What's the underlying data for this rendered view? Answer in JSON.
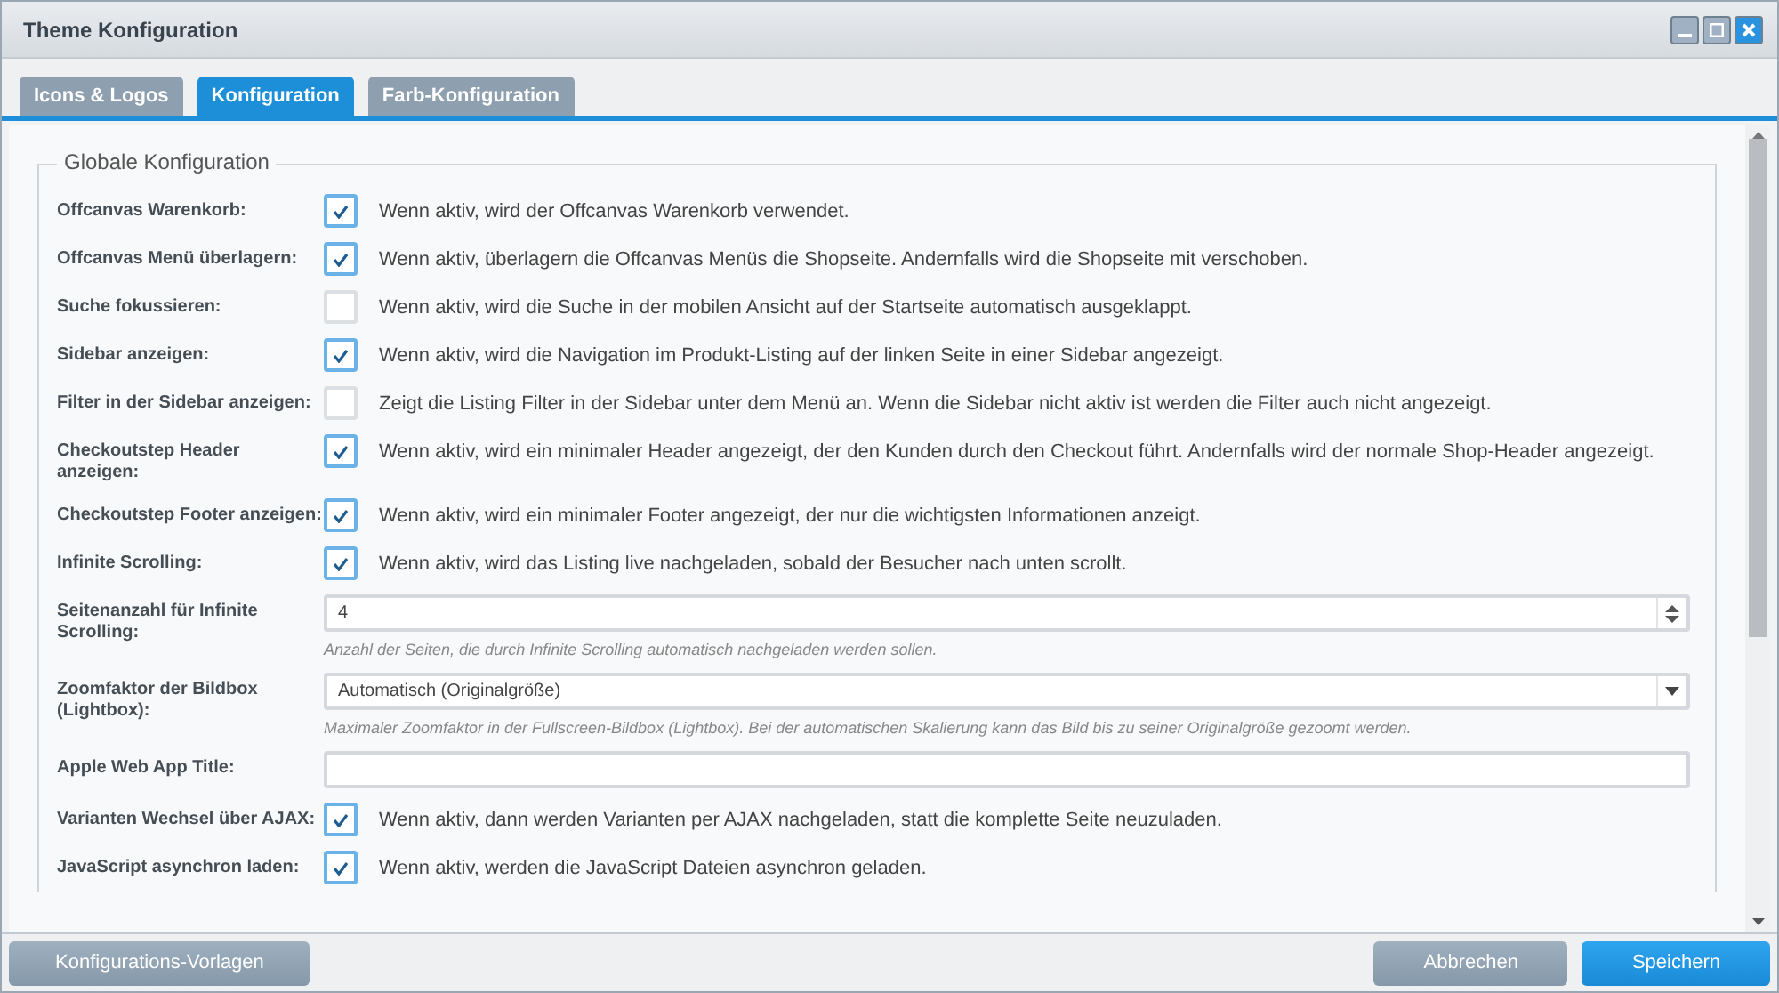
{
  "window": {
    "title": "Theme Konfiguration"
  },
  "tabs": [
    {
      "label": "Icons & Logos",
      "selected": false
    },
    {
      "label": "Konfiguration",
      "selected": true
    },
    {
      "label": "Farb-Konfiguration",
      "selected": false
    }
  ],
  "fieldset": {
    "legend": "Globale Konfiguration"
  },
  "settings": [
    {
      "kind": "checkbox",
      "label": "Offcanvas Warenkorb:",
      "checked": true,
      "description": "Wenn aktiv, wird der Offcanvas Warenkorb verwendet."
    },
    {
      "kind": "checkbox",
      "label": "Offcanvas Menü überlagern:",
      "checked": true,
      "description": "Wenn aktiv, überlagern die Offcanvas Menüs die Shopseite. Andernfalls wird die Shopseite mit verschoben."
    },
    {
      "kind": "checkbox",
      "label": "Suche fokussieren:",
      "checked": false,
      "description": "Wenn aktiv, wird die Suche in der mobilen Ansicht auf der Startseite automatisch ausgeklappt."
    },
    {
      "kind": "checkbox",
      "label": "Sidebar anzeigen:",
      "checked": true,
      "description": "Wenn aktiv, wird die Navigation im Produkt-Listing auf der linken Seite in einer Sidebar angezeigt."
    },
    {
      "kind": "checkbox",
      "label": "Filter in der Sidebar anzeigen:",
      "checked": false,
      "description": "Zeigt die Listing Filter in der Sidebar unter dem Menü an. Wenn die Sidebar nicht aktiv ist werden die Filter auch nicht angezeigt."
    },
    {
      "kind": "checkbox",
      "label": "Checkoutstep Header anzeigen:",
      "checked": true,
      "description": "Wenn aktiv, wird ein minimaler Header angezeigt, der den Kunden durch den Checkout führt. Andernfalls wird der normale Shop-Header angezeigt."
    },
    {
      "kind": "checkbox",
      "label": "Checkoutstep Footer anzeigen:",
      "checked": true,
      "description": "Wenn aktiv, wird ein minimaler Footer angezeigt, der nur die wichtigsten Informationen anzeigt."
    },
    {
      "kind": "checkbox",
      "label": "Infinite Scrolling:",
      "checked": true,
      "description": "Wenn aktiv, wird das Listing live nachgeladen, sobald der Besucher nach unten scrollt."
    },
    {
      "kind": "number",
      "label": "Seitenanzahl für Infinite Scrolling:",
      "value": "4",
      "help": "Anzahl der Seiten, die durch Infinite Scrolling automatisch nachgeladen werden sollen."
    },
    {
      "kind": "select",
      "label": "Zoomfaktor der Bildbox (Lightbox):",
      "value": "Automatisch (Originalgröße)",
      "help": "Maximaler Zoomfaktor in der Fullscreen-Bildbox (Lightbox). Bei der automatischen Skalierung kann das Bild bis zu seiner Originalgröße gezoomt werden."
    },
    {
      "kind": "text",
      "label": "Apple Web App Title:"
    },
    {
      "kind": "checkbox",
      "label": "Varianten Wechsel über AJAX:",
      "checked": true,
      "description": "Wenn aktiv, dann werden Varianten per AJAX nachgeladen, statt die komplette Seite neuzuladen."
    },
    {
      "kind": "checkbox",
      "label": "JavaScript asynchron laden:",
      "checked": true,
      "description": "Wenn aktiv, werden die JavaScript Dateien asynchron geladen."
    }
  ],
  "footer": {
    "templates_button": "Konfigurations-Vorlagen",
    "cancel_button": "Abbrechen",
    "save_button": "Speichern"
  }
}
